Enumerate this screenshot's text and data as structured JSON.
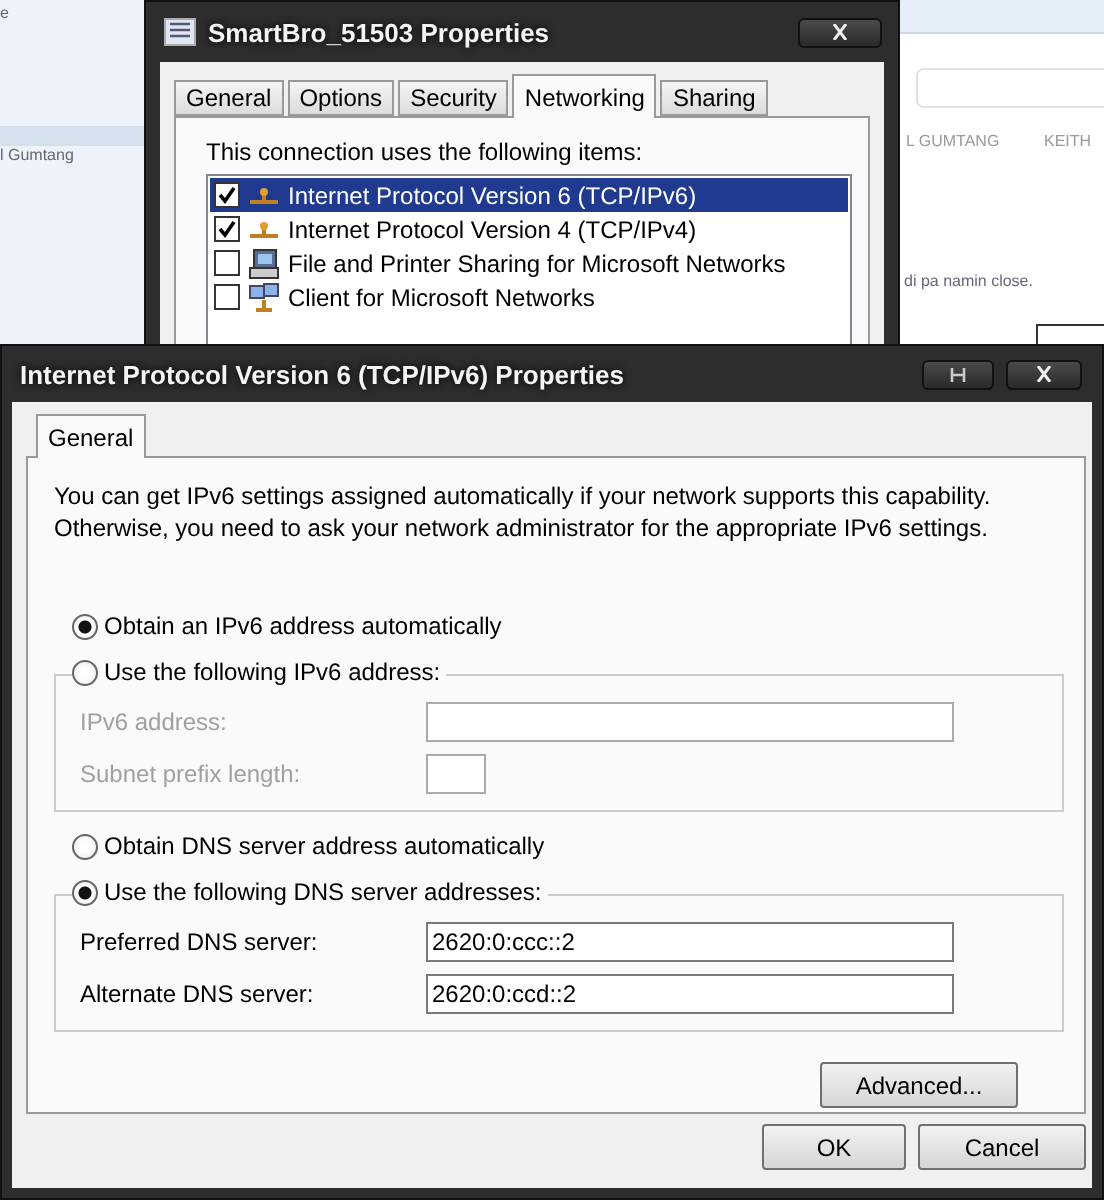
{
  "background_page": {
    "corner_text": "e",
    "sidebar_name": "l Gumtang",
    "column_headers": [
      "L GUMTANG",
      "KEITH"
    ],
    "message": "di pa namin close."
  },
  "back_dialog": {
    "title": "SmartBro_51503 Properties",
    "tabs": [
      {
        "label": "General",
        "selected": false
      },
      {
        "label": "Options",
        "selected": false
      },
      {
        "label": "Security",
        "selected": false
      },
      {
        "label": "Networking",
        "selected": true
      },
      {
        "label": "Sharing",
        "selected": false
      }
    ],
    "items_label": "This connection uses the following items:",
    "items": [
      {
        "label": "Internet Protocol Version 6 (TCP/IPv6)",
        "checked": true,
        "selected": true,
        "kind": "protocol"
      },
      {
        "label": "Internet Protocol Version 4 (TCP/IPv4)",
        "checked": true,
        "selected": false,
        "kind": "protocol"
      },
      {
        "label": "File and Printer Sharing for Microsoft Networks",
        "checked": false,
        "selected": false,
        "kind": "printer"
      },
      {
        "label": "Client for Microsoft Networks",
        "checked": false,
        "selected": false,
        "kind": "client"
      }
    ]
  },
  "dialog": {
    "title": "Internet Protocol Version 6 (TCP/IPv6) Properties",
    "tabs": [
      {
        "label": "General",
        "selected": true
      }
    ],
    "description": "You can get IPv6 settings assigned automatically if your network supports this capability. Otherwise, you need to ask your network administrator for the appropriate IPv6 settings.",
    "sections": [
      {
        "auto_option": {
          "label": "Obtain an IPv6 address automatically",
          "selected": true
        },
        "manual_option": {
          "label": "Use the following IPv6 address:",
          "selected": false
        },
        "fields": [
          {
            "label": "IPv6 address:",
            "disabled": true,
            "kind": "wide"
          },
          {
            "label": "Subnet prefix length:",
            "disabled": true,
            "kind": "short"
          }
        ]
      },
      {
        "auto_option": {
          "label": "Obtain DNS server address automatically",
          "selected": false
        },
        "manual_option": {
          "label": "Use the following DNS server addresses:",
          "selected": true
        },
        "fields": [
          {
            "label": "Preferred DNS server:",
            "value": "2620:0:ccc::2",
            "disabled": false,
            "kind": "wide"
          },
          {
            "label": "Alternate DNS server:",
            "value": "2620:0:ccd::2",
            "disabled": false,
            "kind": "wide"
          }
        ]
      }
    ],
    "advanced_button": "Advanced...",
    "buttons": [
      "OK",
      "Cancel"
    ]
  }
}
